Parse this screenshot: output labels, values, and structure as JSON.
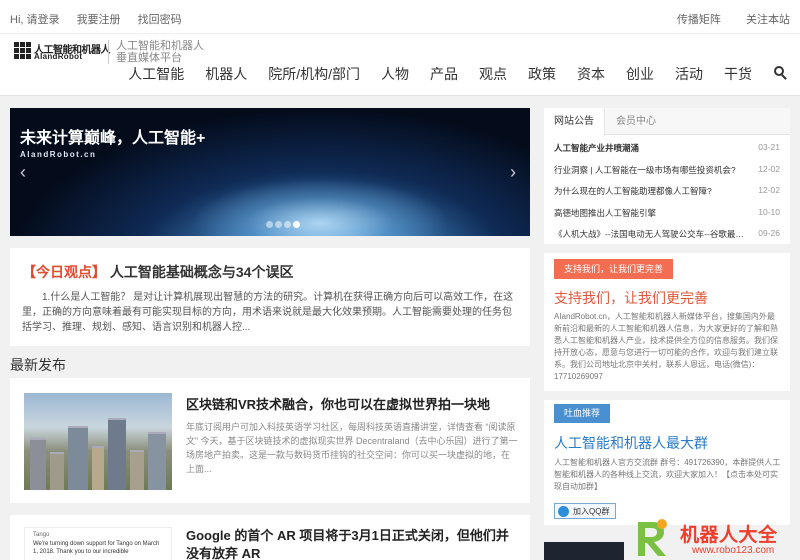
{
  "topbar": {
    "greeting": "Hi, 请登录",
    "register": "我要注册",
    "recover": "找回密码",
    "matrix": "传播矩阵",
    "follow": "关注本站"
  },
  "header": {
    "logo_cn": "人工智能和机器人",
    "logo_en": "AIandRobot",
    "slogan_line1": "人工智能和机器人",
    "slogan_line2": "垂直媒体平台"
  },
  "nav": {
    "items": [
      "人工智能",
      "机器人",
      "院所/机构/部门",
      "人物",
      "产品",
      "观点",
      "政策",
      "资本",
      "创业",
      "活动",
      "干货"
    ],
    "search_icon": "search-icon"
  },
  "banner": {
    "title": "未来计算巅峰，人工智能+",
    "subtitle": "AIandRobot.cn",
    "prev": "‹",
    "next": "›",
    "active_slide": 4,
    "slide_count": 4
  },
  "opinion": {
    "tag": "【今日观点】",
    "title": "人工智能基础概念与34个误区",
    "body": "1.什么是人工智能？ 是对让计算机展现出智慧的方法的研究。计算机在获得正确方向后可以高效工作，在这里，正确的方向意味着最有可能实现目标的方向，用术语来说就是最大化效果预期。人工智能需要处理的任务包括学习、推理、规划、感知、语言识别和机器人控..."
  },
  "latest": {
    "section_title": "最新发布",
    "articles": [
      {
        "title": "区块链和VR技术融合，你也可以在虚拟世界拍一块地",
        "desc": "年底订阅用户可加入科技英语学习社区，每周科技英语直播讲堂，详情查看 “阅读原文” 今天，基于区块链技术的虚拟现实世界 Decentraland（去中心乐园）进行了第一场房地产拍卖。这是一款与数码货币挂钩的社交空间：你可以买一块虚拟的地，在上面..."
      },
      {
        "title": "Google 的首个 AR 项目将于3月1日正式关闭，但他们并没有放弃 AR",
        "thumb_line1": "Tango",
        "thumb_line2": "We're turning down support for Tango on March 1, 2018. Thank you to our incredible"
      }
    ]
  },
  "notice": {
    "tab_active": "网站公告",
    "tab_other": "会员中心",
    "items": [
      {
        "title": "人工智能产业井喷潮涌",
        "date": "03-21",
        "bold": true
      },
      {
        "title": "行业洞察 | 人工智能在一级市场有哪些投资机会?",
        "date": "12-02",
        "bold": false
      },
      {
        "title": "为什么现在的人工智能助理都像人工智障?",
        "date": "12-02",
        "bold": false
      },
      {
        "title": "高德地图推出人工智能引擎",
        "date": "10-10",
        "bold": false
      },
      {
        "title": "《人机大战》--法国电动无人驾驶公交车--谷歌最新...",
        "date": "09-26",
        "bold": false
      }
    ]
  },
  "support": {
    "button": "支持我们，让我们更完善",
    "heading": "支持我们，让我们更完善",
    "text": "AIandRobot.cn，人工智能和机器人新媒体平台，搜集国内外最新前沿和最新的人工智能和机器人信息，为大家更好的了解和熟悉人工智能和机器人产业，技术提供全方位的信息服务。我们保持开放心态，愿意与您进行一切可能的合作，欢迎与我们建立联系。我们公司地址北京中关村，联系人恩远，电话(微信)：17710269097"
  },
  "recommend": {
    "button": "吐血推荐",
    "heading": "人工智能和机器人最大群",
    "text": "人工智能和机器人官方交流群 群号：491726390，本群提供人工智能和机器人的各种线上交流，欢迎大家加入！【点击本处可实现自动加群】",
    "qq_button": "加入QQ群"
  },
  "watermark": {
    "name": "机器人大全",
    "url": "www.robo123.com"
  },
  "colors": {
    "accent_red": "#e0583b",
    "accent_blue": "#2a7bc8",
    "button_red": "#f26d51",
    "button_blue": "#4a8fd0"
  }
}
